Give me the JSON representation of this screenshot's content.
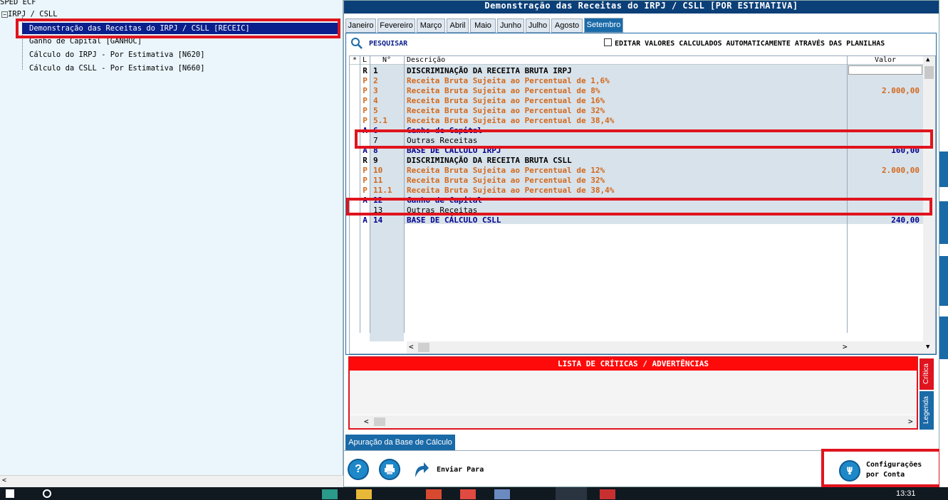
{
  "tree": {
    "root": "SPED ECF",
    "group": "IRPJ / CSLL",
    "items": [
      "Demonstração das Receitas do IRPJ / CSLL [RECEIC]",
      "Ganho de Capital [GANHOC]",
      "Cálculo do IRPJ - Por Estimativa [N620]",
      "Cálculo da CSLL - Por Estimativa [N660]"
    ]
  },
  "dialog": {
    "title": "Demonstração das Receitas do IRPJ / CSLL [POR ESTIMATIVA]",
    "tabs": [
      "Janeiro",
      "Fevereiro",
      "Março",
      "Abril",
      "Maio",
      "Junho",
      "Julho",
      "Agosto",
      "Setembro"
    ],
    "active_tab": "Setembro",
    "search_label": "PESQUISAR",
    "edit_checkbox_label": "EDITAR VALORES CALCULADOS AUTOMATICAMENTE ATRAVÉS DAS PLANILHAS",
    "edit_checkbox_checked": false
  },
  "grid": {
    "headers": {
      "star": "*",
      "l": "L",
      "num": "N°",
      "desc": "Descrição",
      "valor": "Valor"
    },
    "rows": [
      {
        "l": "R",
        "num": "1",
        "desc": "DISCRIMINAÇÃO DA RECEITA BRUTA IRPJ",
        "valor": "",
        "color": "#000000"
      },
      {
        "l": "P",
        "num": "2",
        "desc": "Receita Bruta Sujeita ao Percentual de 1,6%",
        "valor": "",
        "color": "#d2691e"
      },
      {
        "l": "P",
        "num": "3",
        "desc": "Receita Bruta Sujeita ao Percentual de 8%",
        "valor": "2.000,00",
        "color": "#d2691e"
      },
      {
        "l": "P",
        "num": "4",
        "desc": "Receita Bruta Sujeita ao Percentual de 16%",
        "valor": "",
        "color": "#d2691e"
      },
      {
        "l": "P",
        "num": "5",
        "desc": "Receita Bruta Sujeita ao Percentual de 32%",
        "valor": "",
        "color": "#d2691e"
      },
      {
        "l": "P",
        "num": "5.1",
        "desc": "Receita Bruta Sujeita ao Percentual de 38,4%",
        "valor": "",
        "color": "#d2691e"
      },
      {
        "l": "A",
        "num": "6",
        "desc": "Ganho de Capital",
        "valor": "",
        "color": "#00008b"
      },
      {
        "l": "",
        "num": "7",
        "desc": "Outras Receitas",
        "valor": "",
        "color": "#000000"
      },
      {
        "l": "A",
        "num": "8",
        "desc": "BASE DE CÁLCULO IRPJ",
        "valor": "160,00",
        "color": "#00008b"
      },
      {
        "l": "R",
        "num": "9",
        "desc": "DISCRIMINAÇÃO DA RECEITA BRUTA CSLL",
        "valor": "",
        "color": "#000000"
      },
      {
        "l": "P",
        "num": "10",
        "desc": "Receita Bruta Sujeita ao Percentual de 12%",
        "valor": "2.000,00",
        "color": "#d2691e"
      },
      {
        "l": "P",
        "num": "11",
        "desc": "Receita Bruta Sujeita ao Percentual de 32%",
        "valor": "",
        "color": "#d2691e"
      },
      {
        "l": "P",
        "num": "11.1",
        "desc": "Receita Bruta Sujeita ao Percentual de 38,4%",
        "valor": "",
        "color": "#d2691e"
      },
      {
        "l": "A",
        "num": "12",
        "desc": "Ganho de Capital",
        "valor": "",
        "color": "#00008b"
      },
      {
        "l": "",
        "num": "13",
        "desc": "Outras Receitas",
        "valor": "",
        "color": "#000000"
      },
      {
        "l": "A",
        "num": "14",
        "desc": "BASE DE CÁLCULO CSLL",
        "valor": "240,00",
        "color": "#00008b"
      }
    ]
  },
  "critics": {
    "title": "LISTA DE CRÍTICAS / ADVERTÊNCIAS",
    "side_tabs": [
      "Crítica",
      "Legenda"
    ]
  },
  "footer": {
    "bottom_tab": "Apuração da Base de Cálculo",
    "send_label": "Enviar Para",
    "config_label_1": "Configurações",
    "config_label_2": "por Conta"
  },
  "taskbar": {
    "time": "13:31"
  },
  "colors": {
    "accent": "#1a6aa8",
    "title_bar": "#0b3f78",
    "highlight_red": "#e0141e"
  }
}
